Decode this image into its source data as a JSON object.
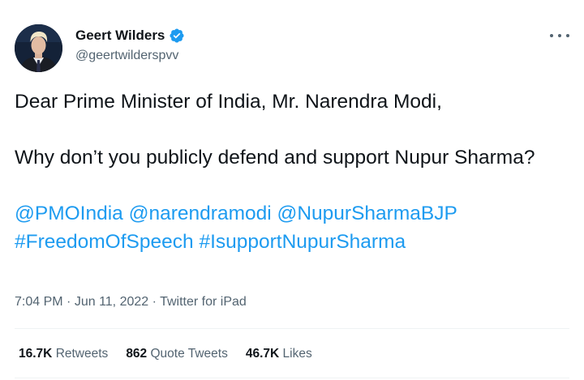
{
  "author": {
    "name": "Geert Wilders",
    "handle": "@geertwilderspvv",
    "verified": true
  },
  "tweet": {
    "line1": "Dear Prime Minister of India, Mr. Narendra Modi,",
    "line2": "Why don’t you publicly defend and support Nupur Sharma?",
    "mentions": [
      "@PMOIndia",
      "@narendramodi",
      "@NupurSharmaBJP"
    ],
    "hashtags": [
      "#FreedomOfSpeech",
      "#IsupportNupurSharma"
    ]
  },
  "meta": {
    "time": "7:04 PM",
    "separator": "·",
    "date": "Jun 11, 2022",
    "source": "Twitter for iPad"
  },
  "stats": {
    "retweets_count": "16.7K",
    "retweets_label": "Retweets",
    "quotes_count": "862",
    "quotes_label": "Quote Tweets",
    "likes_count": "46.7K",
    "likes_label": "Likes"
  },
  "colors": {
    "link": "#1d9bf0",
    "text": "#0f1419",
    "secondary": "#536471",
    "divider": "#eff3f4"
  },
  "icons": {
    "verified": "verified-badge-icon",
    "more": "more-options-icon"
  }
}
